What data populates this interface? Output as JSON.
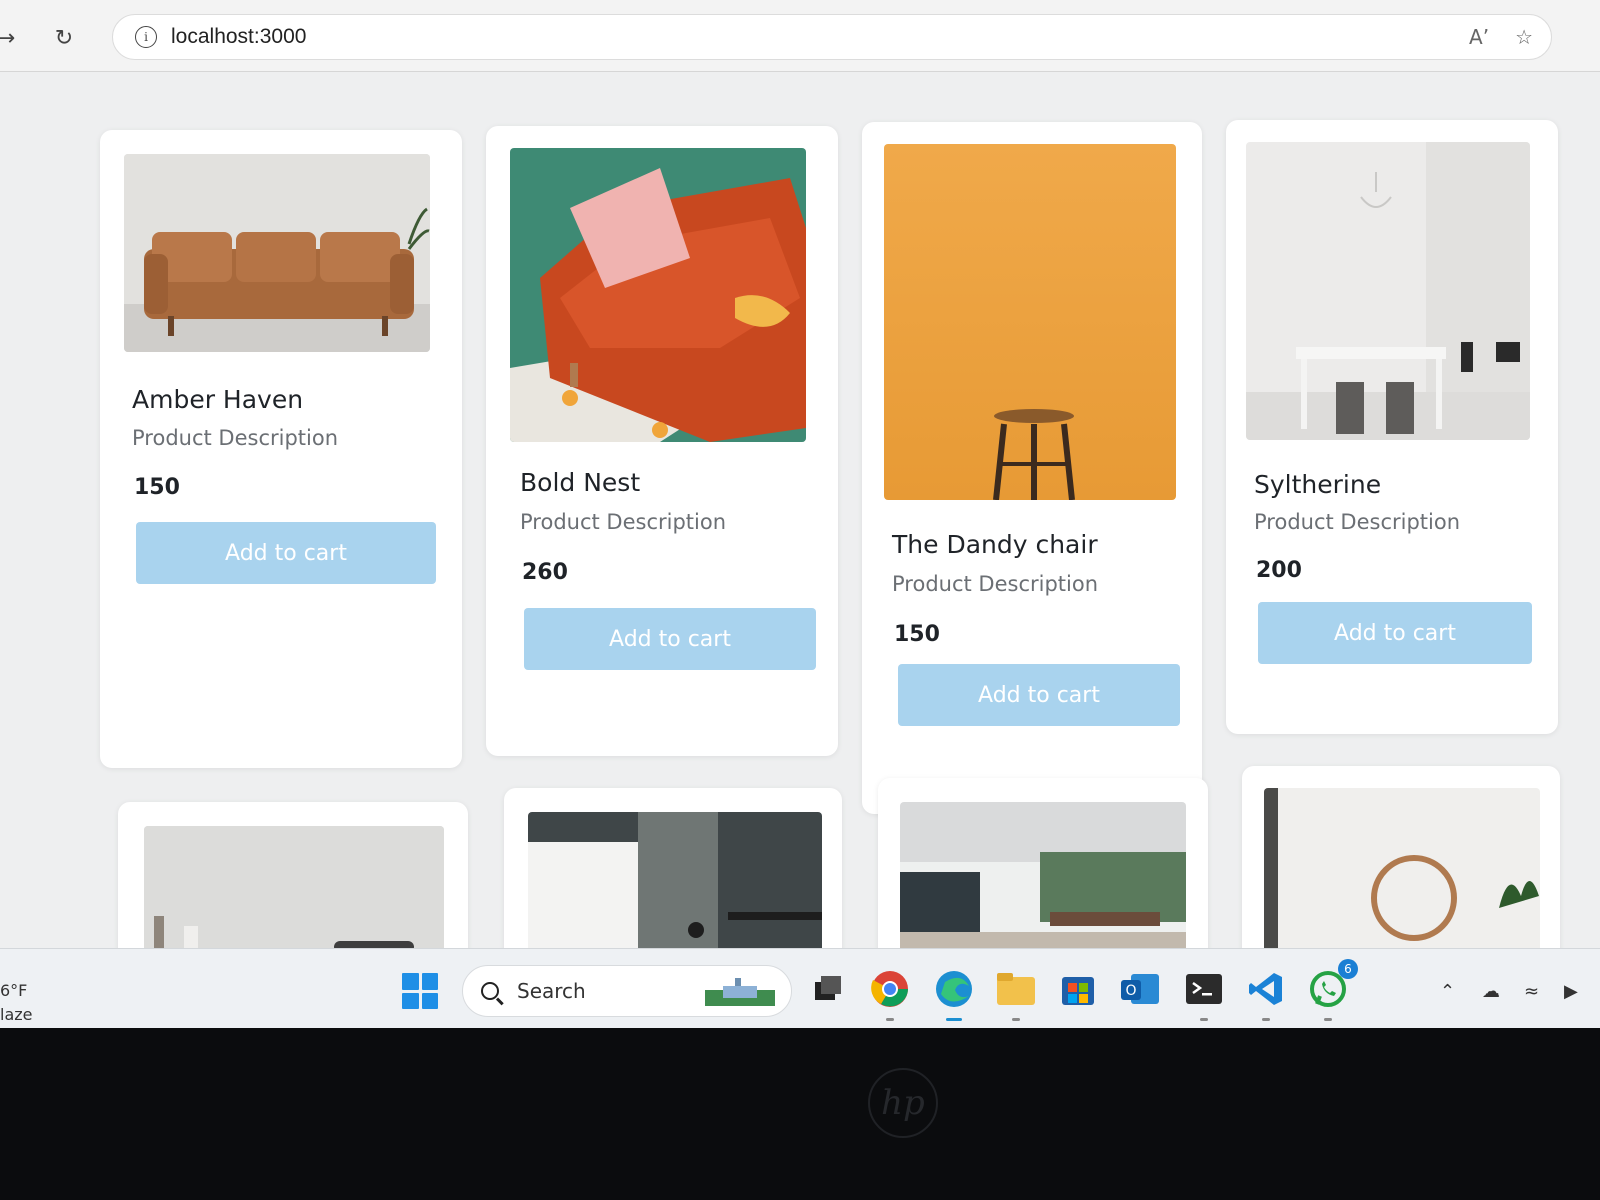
{
  "browser": {
    "url": "localhost:3000",
    "back_icon": "arrow-back-icon",
    "reload_icon": "reload-icon",
    "info_icon": "info-icon",
    "read_aloud_icon": "read-aloud-icon",
    "favorite_icon": "star-icon"
  },
  "products": [
    {
      "name": "Amber Haven",
      "description": "Product Description",
      "price": "150",
      "button": "Add to cart",
      "image": "brown-leather-sofa"
    },
    {
      "name": "Bold Nest",
      "description": "Product Description",
      "price": "260",
      "button": "Add to cart",
      "image": "orange-sofa-pink-pillow"
    },
    {
      "name": "The Dandy chair",
      "description": "Product Description",
      "price": "150",
      "button": "Add to cart",
      "image": "stool-orange-wall"
    },
    {
      "name": "Syltherine",
      "description": "Product Description",
      "price": "200",
      "button": "Add to cart",
      "image": "white-dining-room"
    }
  ],
  "products_row2": [
    {
      "image": "grey-room-decor"
    },
    {
      "image": "dark-stairs-interior"
    },
    {
      "image": "living-room-wide-windows"
    },
    {
      "image": "round-mirror-room"
    }
  ],
  "taskbar": {
    "weather_temp": "6°F",
    "weather_text": "laze",
    "search_label": "Search",
    "whatsapp_badge": "6",
    "apps": [
      "task-view-icon",
      "chrome-icon",
      "edge-icon",
      "file-explorer-icon",
      "microsoft-store-icon",
      "outlook-icon",
      "terminal-icon",
      "vscode-icon",
      "whatsapp-icon"
    ]
  },
  "colors": {
    "accent_button": "#a9d3ee",
    "page_background": "#eeeff0",
    "card_background": "#ffffff"
  }
}
